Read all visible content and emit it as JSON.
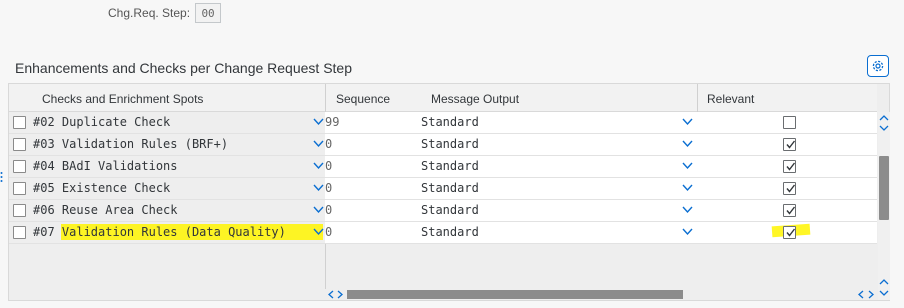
{
  "change_request_step": {
    "label": "Chg.Req. Step:",
    "value": "00"
  },
  "section": {
    "title": "Enhancements and Checks per Change Request Step"
  },
  "table": {
    "headers": {
      "spots": "Checks and Enrichment Spots",
      "sequence": "Sequence",
      "message": "Message Output",
      "relevant": "Relevant"
    },
    "rows": [
      {
        "spot": "#02 Duplicate Check",
        "sequence": "99",
        "message": "Standard",
        "relevant": false
      },
      {
        "spot": "#03 Validation Rules (BRF+)",
        "sequence": "0",
        "message": "Standard",
        "relevant": true
      },
      {
        "spot": "#04 BAdI Validations",
        "sequence": "0",
        "message": "Standard",
        "relevant": true
      },
      {
        "spot": "#05 Existence Check",
        "sequence": "0",
        "message": "Standard",
        "relevant": true
      },
      {
        "spot": "#06 Reuse Area Check",
        "sequence": "0",
        "message": "Standard",
        "relevant": true
      },
      {
        "spot": "#07 Validation Rules (Data Quality)",
        "sequence": "0",
        "message": "Standard",
        "relevant": true
      }
    ]
  },
  "icons": {
    "settings": "settings-gear-icon",
    "dropdown": "chevron-down-icon",
    "checkmark": "checkmark-icon",
    "scroll_up": "chevron-up-icon",
    "scroll_down": "chevron-down-icon",
    "scroll_left": "chevron-left-icon",
    "scroll_right": "chevron-right-icon"
  },
  "colors": {
    "accent": "#0a6ed1",
    "highlight": "#fff500"
  }
}
